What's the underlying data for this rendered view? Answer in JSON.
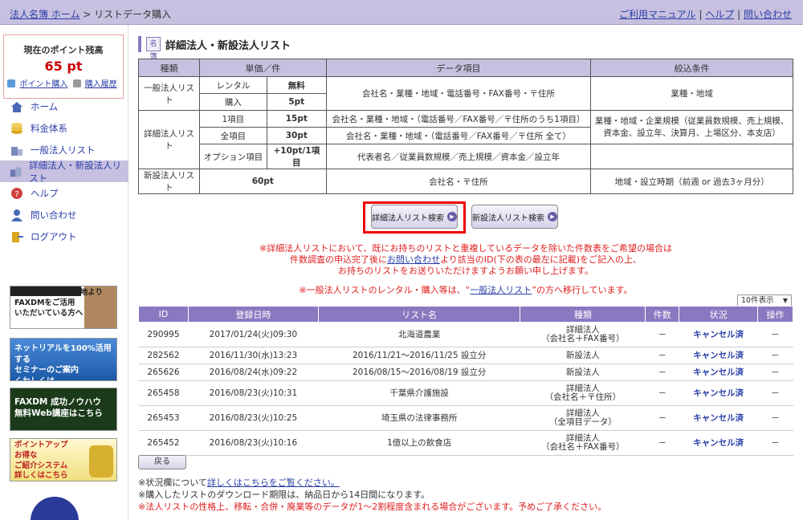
{
  "header": {
    "crumb_home": "法人名簿 ホーム",
    "crumb_sep": " > ",
    "crumb_current": "リストデータ購入",
    "manual": "ご利用マニュアル",
    "help": "ヘルプ",
    "contact": "問い合わせ",
    "sep": " | "
  },
  "points": {
    "title": "現在のポイント残高",
    "value": "65 pt",
    "buy": "ポイント購入",
    "history": "購入履歴"
  },
  "nav": [
    {
      "label": "ホーム"
    },
    {
      "label": "料金体系"
    },
    {
      "label": "一般法人リスト"
    },
    {
      "label": "詳細法人・新設法人リスト"
    },
    {
      "label": "ヘルプ"
    },
    {
      "label": "問い合わせ"
    },
    {
      "label": "ログアウト"
    }
  ],
  "banners": [
    {
      "text": "NetReal! 代表 浅地より\nFAXDMをご活用\nいただいている方へ"
    },
    {
      "text": "ネットリアルを100%活用する\nセミナーのご案内\nくわしくは"
    },
    {
      "text": "FAXDM 成功ノウハウ\n無料Web講座はこちら"
    },
    {
      "text": "ポイントアップ\nお得な\nご紹介システム\n詳しくはこちら"
    }
  ],
  "page": {
    "icon": "名簿",
    "title": "詳細法人・新設法人リスト"
  },
  "price_table": {
    "headers": [
      "種類",
      "単価／件",
      "データ項目",
      "絞込条件"
    ],
    "general": {
      "label": "一般法人リスト",
      "rental": "レンタル",
      "rental_price": "無料",
      "purchase": "購入",
      "purchase_price": "5pt",
      "items": "会社名・業種・地域・電話番号・FAX番号・〒住所",
      "filter": "業種・地域"
    },
    "detail": {
      "label": "詳細法人リスト",
      "one": "1項目",
      "one_price": "15pt",
      "one_items": "会社名・業種・地域・（電話番号／FAX番号／〒住所のうち1項目）",
      "all": "全項目",
      "all_price": "30pt",
      "all_items": "会社名・業種・地域・（電話番号／FAX番号／〒住所 全て）",
      "option": "オプション項目",
      "option_price": "+10pt/1項目",
      "option_items": "代表者名／従業員数規模／売上規模／資本金／設立年",
      "filter": "業種・地域・企業規模（従業員数規模、売上規模、\n資本金、設立年、決算月、上場区分、本支店）"
    },
    "new": {
      "label": "新設法人リスト",
      "price": "60pt",
      "items": "会社名・〒住所",
      "filter": "地域・設立時期（前週 or 過去3ヶ月分）"
    }
  },
  "buttons": {
    "detail_search": "詳細法人リスト検索",
    "new_search": "新設法人リスト検索",
    "back": "戻る"
  },
  "notice": {
    "line1": "※詳細法人リストにおいて、既にお持ちのリストと重複しているデータを除いた件数表をご希望の場合は",
    "line2a": "件数調査の申込完了後に",
    "line2_link": "お問い合わせ",
    "line2b": "より該当のID(下の表の最左に記載)をご記入の上、",
    "line3": "お持ちのリストをお送りいただけますようお願い申し上げます。",
    "move_a": "※一般法人リストのレンタル・購入等は、“",
    "move_link": "一般法人リスト",
    "move_b": "”の方へ移行しています。"
  },
  "per_page": "10件表示",
  "list": {
    "headers": [
      "ID",
      "登録日時",
      "リスト名",
      "種類",
      "件数",
      "状況",
      "操作"
    ],
    "rows": [
      {
        "id": "290995",
        "date": "2017/01/24(火)09:30",
        "name": "北海道農業",
        "type1": "詳細法人",
        "type2": "（会社名＋FAX番号）",
        "count": "－",
        "status": "キャンセル済",
        "op": "－"
      },
      {
        "id": "282562",
        "date": "2016/11/30(水)13:23",
        "name": "2016/11/21～2016/11/25 設立分",
        "type1": "新設法人",
        "type2": "",
        "count": "－",
        "status": "キャンセル済",
        "op": "－"
      },
      {
        "id": "265626",
        "date": "2016/08/24(水)09:22",
        "name": "2016/08/15～2016/08/19 設立分",
        "type1": "新設法人",
        "type2": "",
        "count": "－",
        "status": "キャンセル済",
        "op": "－"
      },
      {
        "id": "265458",
        "date": "2016/08/23(火)10:31",
        "name": "千葉県介護施設",
        "type1": "詳細法人",
        "type2": "（会社名＋〒住所）",
        "count": "－",
        "status": "キャンセル済",
        "op": "－"
      },
      {
        "id": "265453",
        "date": "2016/08/23(火)10:25",
        "name": "埼玉県の法律事務所",
        "type1": "詳細法人",
        "type2": "（全項目データ）",
        "count": "－",
        "status": "キャンセル済",
        "op": "－"
      },
      {
        "id": "265452",
        "date": "2016/08/23(火)10:16",
        "name": "1億以上の飲食店",
        "type1": "詳細法人",
        "type2": "（会社名＋FAX番号）",
        "count": "－",
        "status": "キャンセル済",
        "op": "－"
      }
    ]
  },
  "footer": {
    "l1a": "※状況欄について",
    "l1_link": "詳しくはこちらをご覧ください。",
    "l2": "※購入したリストのダウンロード期限は、納品日から14日間になります。",
    "l3": "※法人リストの性格上、移転・合併・廃業等のデータが1～2割程度含まれる場合がございます。予めご了承ください。"
  },
  "colors": {
    "accent": "#8a78c0",
    "header_bg": "#c8c0e0",
    "link": "#2a3fa8",
    "alert": "#e02020",
    "highlight": "#e00000"
  }
}
